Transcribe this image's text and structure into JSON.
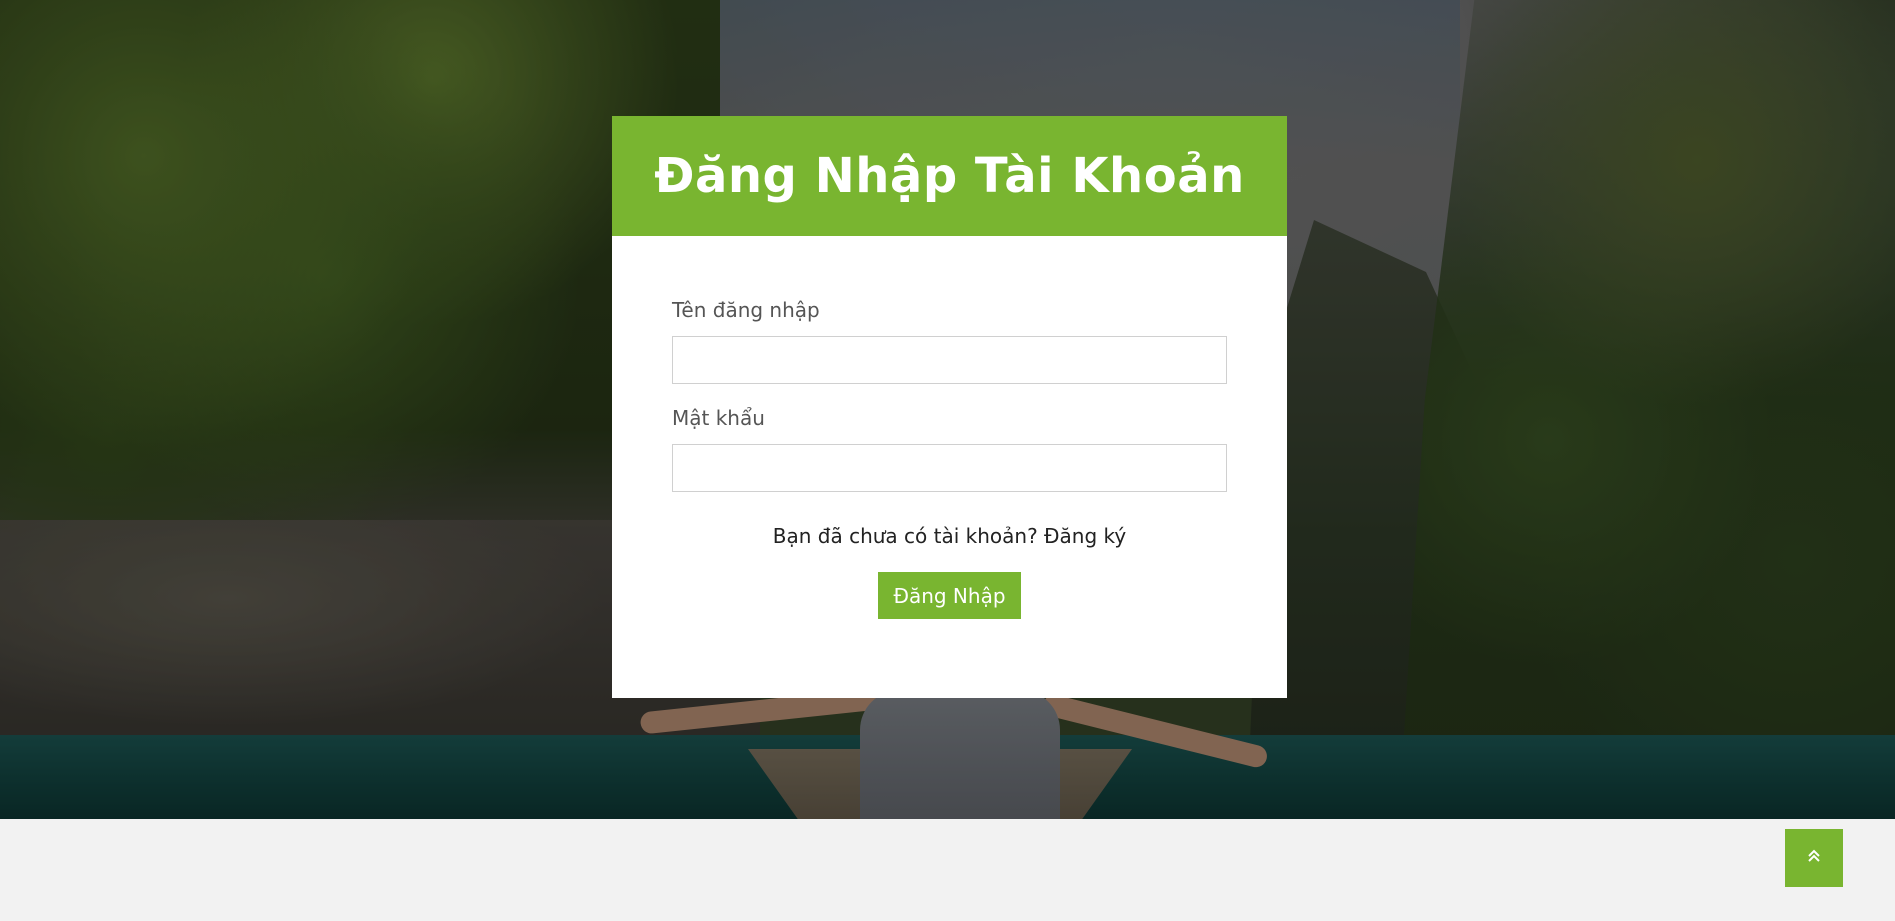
{
  "login": {
    "title": "Đăng Nhập Tài Khoản",
    "username_label": "Tên đăng nhập",
    "username_value": "",
    "password_label": "Mật khẩu",
    "password_value": "",
    "register_prompt": "Bạn đã chưa có tài khoản?",
    "register_link": "Đăng ký",
    "submit_label": "Đăng Nhập"
  },
  "colors": {
    "accent": "#79b530",
    "footer_bg": "#f2f2f2"
  },
  "icons": {
    "back_to_top": "double-chevron-up-icon"
  }
}
